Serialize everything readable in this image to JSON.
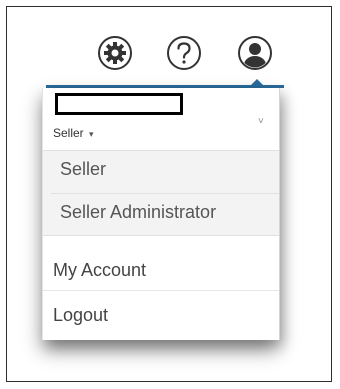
{
  "header": {
    "icons": [
      "gear-icon",
      "help-icon",
      "user-icon"
    ],
    "accent_color": "#2a6c9c"
  },
  "user_menu": {
    "role_selector": {
      "label": "Seller",
      "caret": "▾"
    },
    "roles": [
      "Seller",
      "Seller Administrator"
    ],
    "items": [
      "My Account",
      "Logout"
    ]
  }
}
